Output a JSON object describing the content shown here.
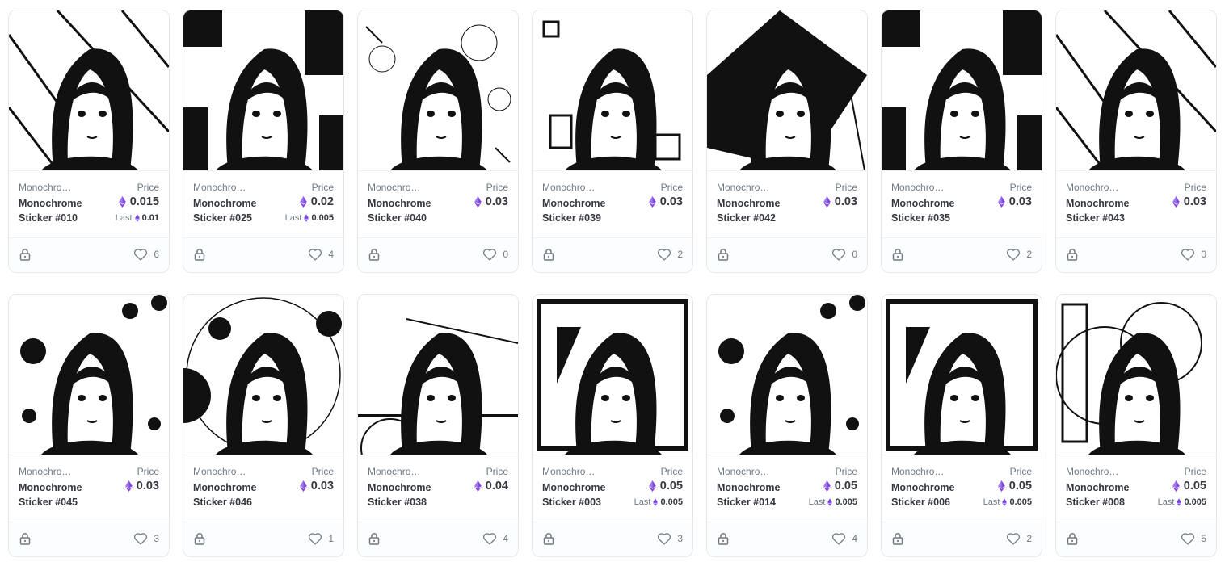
{
  "colors": {
    "eth": "#8247e5",
    "border": "#e5e8eb",
    "muted": "#707a83",
    "text": "#353840"
  },
  "icons": {
    "currency": "ethereum-icon",
    "lock": "lock-icon",
    "like": "heart-icon"
  },
  "cards": [
    {
      "collection": "Monochrome Stickers",
      "name": "Monochrome Sticker #010",
      "price_label": "Price",
      "price": "0.015",
      "last_label": "Last",
      "last": "0.01",
      "likes": "6",
      "art": "boy-lines"
    },
    {
      "collection": "Monochrome Stickers",
      "name": "Monochrome Sticker #025",
      "price_label": "Price",
      "price": "0.02",
      "last_label": "Last",
      "last": "0.005",
      "likes": "4",
      "art": "boy-blocks"
    },
    {
      "collection": "Monochrome Stickers",
      "name": "Monochrome Sticker #040",
      "price_label": "Price",
      "price": "0.03",
      "likes": "0",
      "art": "girl-flowers"
    },
    {
      "collection": "Monochrome Stickers",
      "name": "Monochrome Sticker #039",
      "price_label": "Price",
      "price": "0.03",
      "likes": "2",
      "art": "girl-squares"
    },
    {
      "collection": "Monochrome Stickers",
      "name": "Monochrome Sticker #042",
      "price_label": "Price",
      "price": "0.03",
      "likes": "0",
      "art": "boy-diamond"
    },
    {
      "collection": "Monochrome Stickers",
      "name": "Monochrome Sticker #035",
      "price_label": "Price",
      "price": "0.03",
      "likes": "2",
      "art": "boy-blocks-2"
    },
    {
      "collection": "Monochrome Stickers",
      "name": "Monochrome Sticker #043",
      "price_label": "Price",
      "price": "0.03",
      "likes": "0",
      "art": "girl-lines"
    },
    {
      "collection": "Monochrome Stickers",
      "name": "Monochrome Sticker #045",
      "price_label": "Price",
      "price": "0.03",
      "likes": "3",
      "art": "girl-dots"
    },
    {
      "collection": "Monochrome Stickers",
      "name": "Monochrome Sticker #046",
      "price_label": "Price",
      "price": "0.03",
      "likes": "1",
      "art": "girl-circles"
    },
    {
      "collection": "Monochrome Stickers",
      "name": "Monochrome Sticker #038",
      "price_label": "Price",
      "price": "0.04",
      "likes": "4",
      "art": "girl-cap"
    },
    {
      "collection": "Monochrome Stickers",
      "name": "Monochrome Sticker #003",
      "price_label": "Price",
      "price": "0.05",
      "last_label": "Last",
      "last": "0.005",
      "likes": "3",
      "art": "girl-frame"
    },
    {
      "collection": "Monochrome Stickers",
      "name": "Monochrome Sticker #014",
      "price_label": "Price",
      "price": "0.05",
      "last_label": "Last",
      "last": "0.005",
      "likes": "4",
      "art": "girl-dots-2"
    },
    {
      "collection": "Monochrome Stickers",
      "name": "Monochrome Sticker #006",
      "price_label": "Price",
      "price": "0.05",
      "last_label": "Last",
      "last": "0.005",
      "likes": "2",
      "art": "girl-glasses"
    },
    {
      "collection": "Monochrome Stickers",
      "name": "Monochrome Sticker #008",
      "price_label": "Price",
      "price": "0.05",
      "last_label": "Last",
      "last": "0.005",
      "likes": "5",
      "art": "girl-arcs"
    }
  ]
}
